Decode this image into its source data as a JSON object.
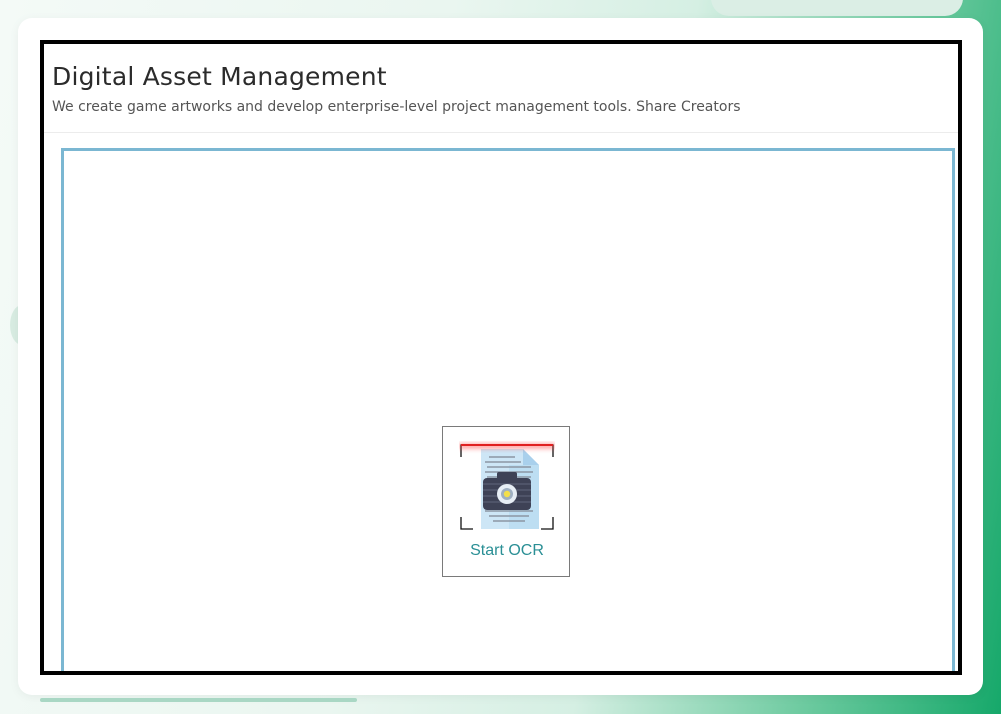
{
  "header": {
    "title": "Digital Asset Management",
    "subtitle": "We create game artworks and develop enterprise-level project management tools. Share Creators"
  },
  "ocr": {
    "button_label": "Start OCR",
    "icon": "ocr-scan-document-camera-icon"
  },
  "colors": {
    "frame_border": "#000000",
    "content_border": "#7bb7d2",
    "button_label": "#2a8f95",
    "scan_line": "#e02020",
    "background_accent": "#16a86a"
  }
}
